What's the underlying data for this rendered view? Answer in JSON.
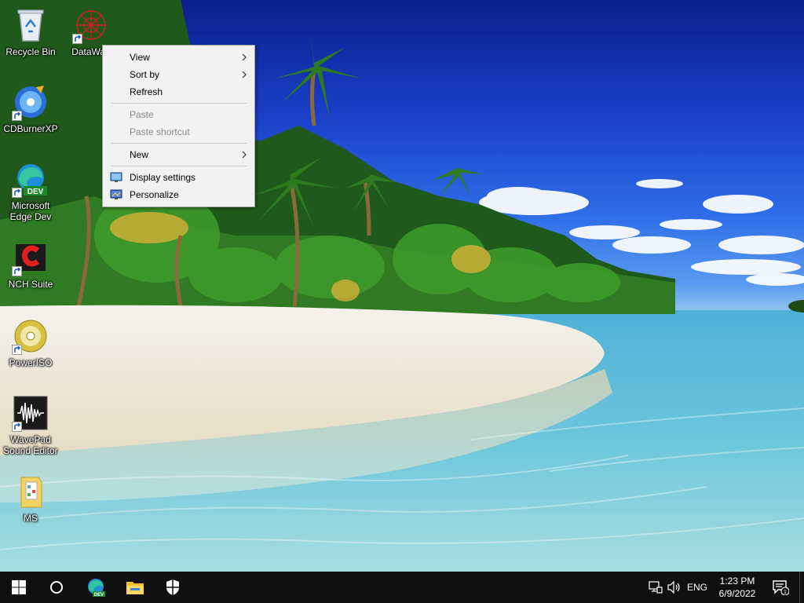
{
  "desktop": {
    "icons": [
      {
        "label": "Recycle Bin",
        "icon": "recycle-bin-icon"
      },
      {
        "label": "DataWag",
        "icon": "datawag-icon"
      },
      {
        "label": "CDBurnerXP",
        "icon": "cdburnerxp-icon"
      },
      {
        "label": "Microsoft\nEdge Dev",
        "icon": "edge-dev-icon"
      },
      {
        "label": "NCH Suite",
        "icon": "nch-suite-icon"
      },
      {
        "label": "PowerISO",
        "icon": "poweriso-icon"
      },
      {
        "label": "WavePad\nSound Editor",
        "icon": "wavepad-icon"
      },
      {
        "label": "MS",
        "icon": "folder-icon"
      }
    ],
    "edge_badge": "DEV"
  },
  "context_menu": {
    "items": [
      {
        "label": "View",
        "submenu": true,
        "enabled": true
      },
      {
        "label": "Sort by",
        "submenu": true,
        "enabled": true
      },
      {
        "label": "Refresh",
        "submenu": false,
        "enabled": true
      },
      {
        "label": "Paste",
        "submenu": false,
        "enabled": false
      },
      {
        "label": "Paste shortcut",
        "submenu": false,
        "enabled": false
      },
      {
        "label": "New",
        "submenu": true,
        "enabled": true
      },
      {
        "label": "Display settings",
        "submenu": false,
        "enabled": true,
        "icon": "display-settings-icon"
      },
      {
        "label": "Personalize",
        "submenu": false,
        "enabled": true,
        "icon": "personalize-icon"
      }
    ]
  },
  "taskbar": {
    "pinned": [
      "start-icon",
      "search-circle-icon",
      "edge-dev-icon",
      "file-explorer-icon",
      "security-shield-icon"
    ],
    "tray": {
      "language": "ENG",
      "time": "1:23 PM",
      "date": "6/9/2022",
      "notification_count": "1"
    }
  },
  "colors": {
    "taskbar": "#101010",
    "menu_bg": "#f2f2f2",
    "menu_disabled_text": "#8c8c8c"
  }
}
